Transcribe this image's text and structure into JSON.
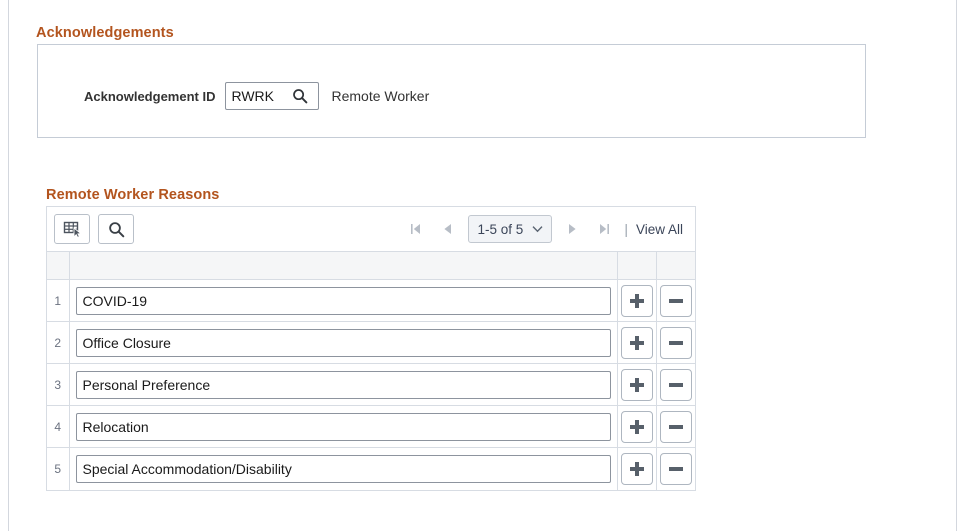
{
  "sections": {
    "acknowledgements": {
      "title": "Acknowledgements",
      "field": {
        "label": "Acknowledgement ID",
        "value": "RWRK",
        "placeholder": "",
        "lookup_icon": "magnifier-icon",
        "description": "Remote Worker"
      }
    },
    "remote_worker_reasons": {
      "title": "Remote Worker Reasons",
      "toolbar": {
        "personalize_icon": "grid-personalize-icon",
        "find_icon": "magnifier-icon"
      },
      "pager": {
        "first_label": "|◀",
        "prev_label": "◀",
        "range_label": "1-5 of 5",
        "chevron_icon": "chevron-down-icon",
        "next_label": "▶",
        "last_label": "▶|",
        "separator": "|",
        "view_all_label": "View All"
      },
      "columns": [
        {
          "key": "rownum",
          "header": ""
        },
        {
          "key": "description",
          "header": ""
        },
        {
          "key": "add",
          "header": ""
        },
        {
          "key": "delete",
          "header": ""
        }
      ],
      "rows": [
        {
          "num": "1",
          "description": "COVID-19",
          "add_label": "+",
          "delete_label": "−"
        },
        {
          "num": "2",
          "description": "Office Closure",
          "add_label": "+",
          "delete_label": "−"
        },
        {
          "num": "3",
          "description": "Personal Preference",
          "add_label": "+",
          "delete_label": "−"
        },
        {
          "num": "4",
          "description": "Relocation",
          "add_label": "+",
          "delete_label": "−"
        },
        {
          "num": "5",
          "description": "Special Accommodation/Disability",
          "add_label": "+",
          "delete_label": "−"
        }
      ]
    }
  },
  "colors": {
    "section_title": "#b3541e",
    "panel_border": "#c5ccd6",
    "grid_border": "#d7dce3",
    "header_fill": "#f5f6f7",
    "input_border": "#8d949e",
    "pager_fill": "#f2f4f7",
    "page_background": "#ffffff"
  }
}
